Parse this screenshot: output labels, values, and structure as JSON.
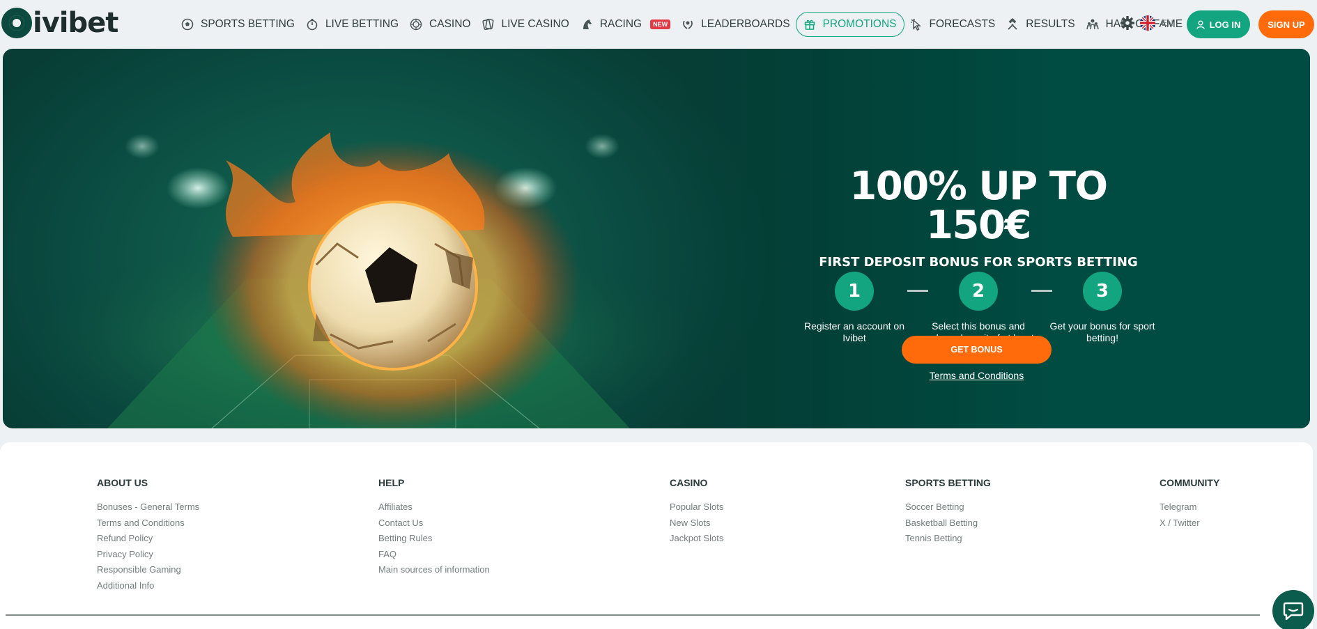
{
  "brand": {
    "name": "ivibet"
  },
  "nav": [
    {
      "label": "SPORTS BETTING",
      "icon": "soccer-ball-icon"
    },
    {
      "label": "LIVE BETTING",
      "icon": "stopwatch-icon"
    },
    {
      "label": "CASINO",
      "icon": "roulette-icon"
    },
    {
      "label": "LIVE CASINO",
      "icon": "cards-icon"
    },
    {
      "label": "RACING",
      "icon": "horse-icon",
      "badge": "NEW"
    },
    {
      "label": "LEADERBOARDS",
      "icon": "laurel-icon"
    },
    {
      "label": "PROMOTIONS",
      "icon": "gift-icon",
      "active": true
    },
    {
      "label": "FORECASTS",
      "icon": "cursor-icon"
    },
    {
      "label": "RESULTS",
      "icon": "hammers-icon"
    },
    {
      "label": "HALL OF FAME",
      "icon": "people-icon"
    }
  ],
  "header": {
    "lang": "EN",
    "login_label": "LOG IN",
    "signup_label": "SIGN UP"
  },
  "promo": {
    "title": "100% UP TO 150€",
    "subtitle": "FIRST DEPOSIT BONUS FOR SPORTS BETTING",
    "steps": [
      {
        "num": "1",
        "text": "Register an account on Ivibet"
      },
      {
        "num": "2",
        "text": "Select this bonus and make a deposit of at least €/$10"
      },
      {
        "num": "3",
        "text": "Get your bonus for sport betting!"
      }
    ],
    "cta_label": "GET BONUS",
    "terms_label": "Terms and Conditions"
  },
  "footer": {
    "columns": [
      {
        "title": "ABOUT US",
        "links": [
          "Bonuses - General Terms",
          "Terms and Conditions",
          "Refund Policy",
          "Privacy Policy",
          "Responsible Gaming",
          "Additional Info"
        ]
      },
      {
        "title": "HELP",
        "links": [
          "Affiliates",
          "Contact Us",
          "Betting Rules",
          "FAQ",
          "Main sources of information"
        ]
      },
      {
        "title": "CASINO",
        "links": [
          "Popular Slots",
          "New Slots",
          "Jackpot Slots"
        ]
      },
      {
        "title": "SPORTS BETTING",
        "links": [
          "Soccer Betting",
          "Basketball Betting",
          "Tennis Betting"
        ]
      },
      {
        "title": "COMMUNITY",
        "links": [
          "Telegram",
          "X / Twitter"
        ]
      }
    ]
  },
  "colors": {
    "accent": "#13a57f",
    "orange": "#ff6b0a",
    "hero_bg": "#004b42"
  }
}
